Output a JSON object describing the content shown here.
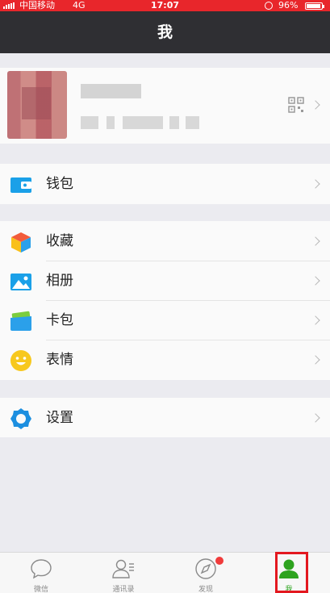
{
  "status_bar": {
    "carrier": "中国移动",
    "network": "4G",
    "time": "17:07",
    "battery_percent": "96%",
    "battery_level": 0.96
  },
  "header": {
    "title": "我"
  },
  "profile": {
    "qr_icon": "qr-code-icon"
  },
  "menu": {
    "wallet": {
      "label": "钱包",
      "icon": "wallet-icon"
    },
    "favorites": {
      "label": "收藏",
      "icon": "cube-icon"
    },
    "album": {
      "label": "相册",
      "icon": "album-icon"
    },
    "cards": {
      "label": "卡包",
      "icon": "card-wallet-icon"
    },
    "stickers": {
      "label": "表情",
      "icon": "smiley-icon"
    },
    "settings": {
      "label": "设置",
      "icon": "gear-icon"
    }
  },
  "tabbar": {
    "tabs": [
      {
        "label": "微信",
        "icon": "chat-bubble-icon"
      },
      {
        "label": "通讯录",
        "icon": "contacts-icon"
      },
      {
        "label": "发现",
        "icon": "compass-icon"
      },
      {
        "label": "我",
        "icon": "person-icon",
        "active": true
      }
    ]
  },
  "colors": {
    "status_bar": "#e8262b",
    "nav_bar": "#2f2f33",
    "active_tab": "#2ea31f",
    "highlight_box": "#e3181f"
  }
}
